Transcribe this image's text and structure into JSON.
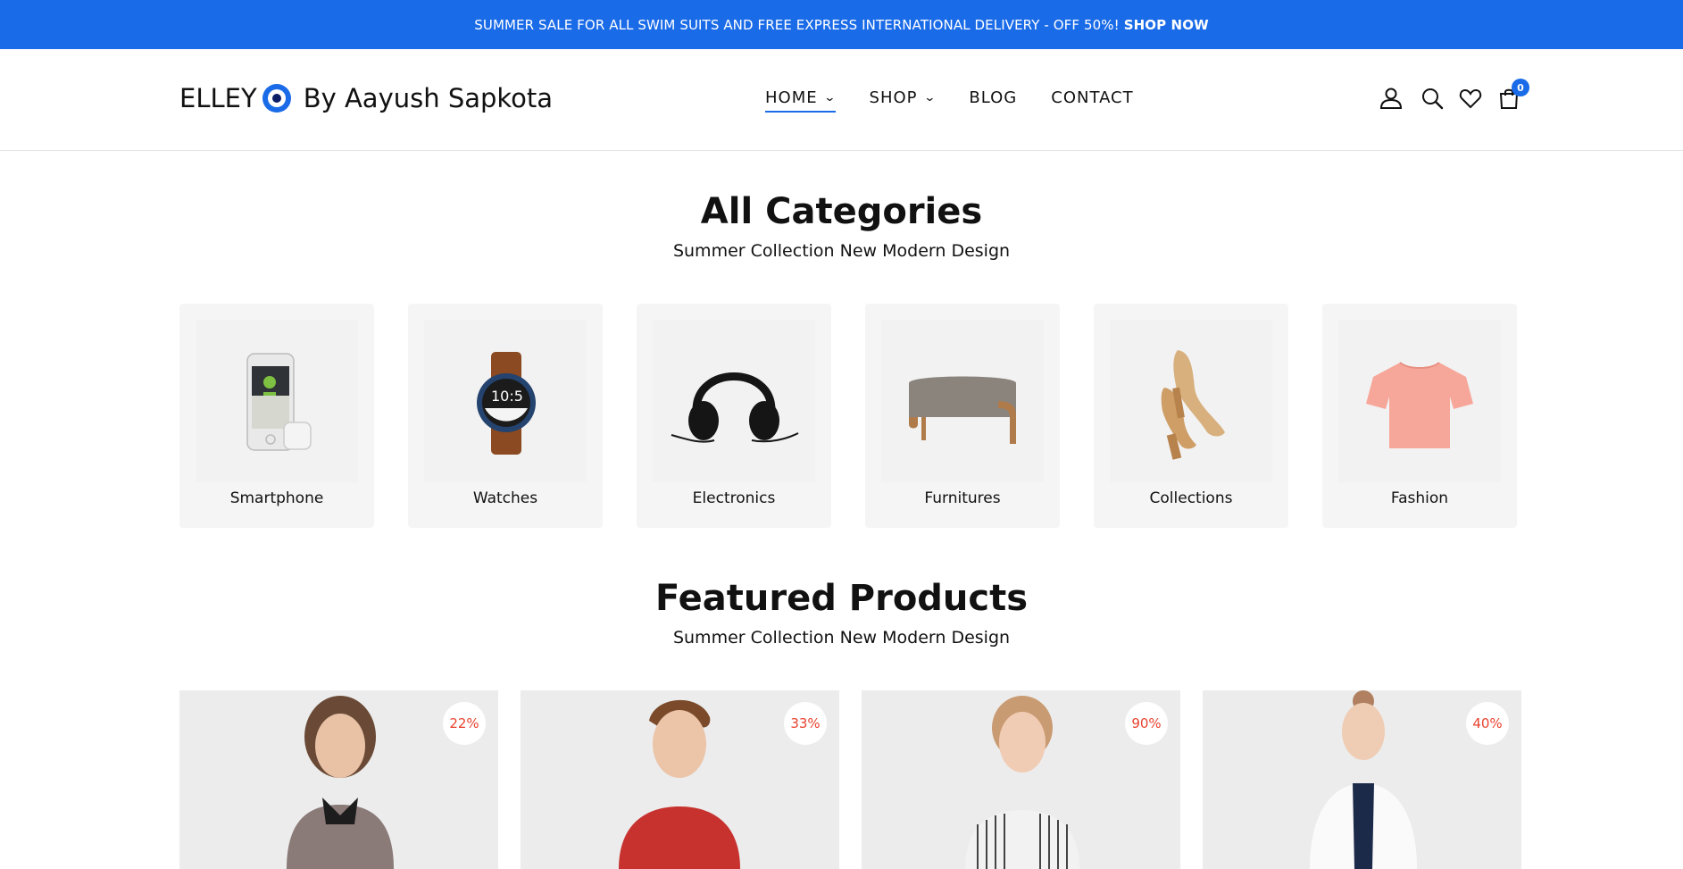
{
  "announcement": {
    "text": "SUMMER SALE FOR ALL SWIM SUITS AND FREE EXPRESS INTERNATIONAL DELIVERY - OFF 50%!",
    "cta": "SHOP NOW"
  },
  "header": {
    "logo_left": "ELLEY",
    "logo_right": "By Aayush Sapkota",
    "nav": [
      {
        "label": "HOME",
        "has_dropdown": true,
        "active": true
      },
      {
        "label": "SHOP",
        "has_dropdown": true,
        "active": false
      },
      {
        "label": "BLOG",
        "has_dropdown": false,
        "active": false
      },
      {
        "label": "CONTACT",
        "has_dropdown": false,
        "active": false
      }
    ],
    "icons": [
      "user-icon",
      "search-icon",
      "heart-icon",
      "cart-icon"
    ],
    "cart_count": "0"
  },
  "categories": {
    "title": "All Categories",
    "subtitle": "Summer Collection New Modern Design",
    "items": [
      {
        "label": "Smartphone",
        "icon": "smartphone-icon"
      },
      {
        "label": "Watches",
        "icon": "watch-icon"
      },
      {
        "label": "Electronics",
        "icon": "headphones-icon"
      },
      {
        "label": "Furnitures",
        "icon": "ottoman-icon"
      },
      {
        "label": "Collections",
        "icon": "sandals-icon"
      },
      {
        "label": "Fashion",
        "icon": "tshirt-icon"
      }
    ]
  },
  "featured": {
    "title": "Featured Products",
    "subtitle": "Summer Collection New Modern Design",
    "products": [
      {
        "discount": "22%"
      },
      {
        "discount": "33%"
      },
      {
        "discount": "90%"
      },
      {
        "discount": "40%"
      }
    ]
  },
  "colors": {
    "accent": "#1a6be8",
    "discount": "#e8422f",
    "card_bg": "#f5f5f5"
  }
}
